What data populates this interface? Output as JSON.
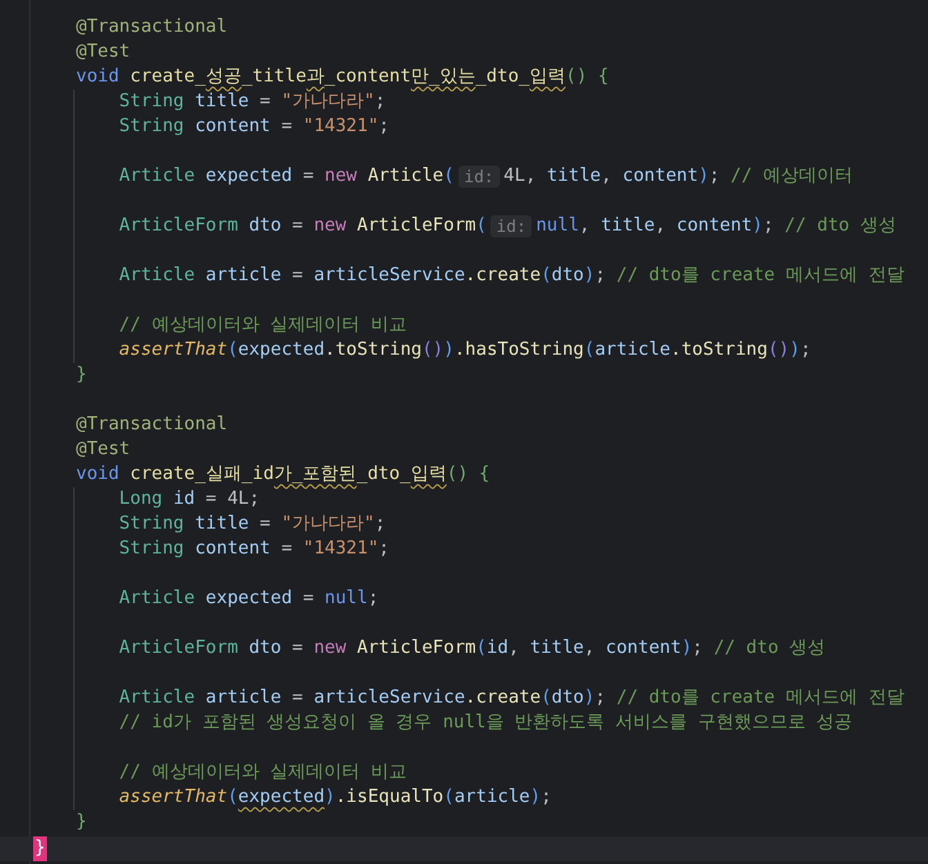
{
  "editor": {
    "lines": [
      {
        "kind": "code",
        "tokens": [
          {
            "text": "@Transactional",
            "kind": "annotation"
          }
        ]
      },
      {
        "kind": "code",
        "tokens": [
          {
            "text": "@Test",
            "kind": "annotation"
          }
        ]
      },
      {
        "kind": "code",
        "tokens": [
          {
            "text": "void ",
            "kind": "keyword"
          },
          {
            "text": "create_",
            "kind": "method"
          },
          {
            "text": "성공",
            "kind": "method",
            "warning": true
          },
          {
            "text": "_title",
            "kind": "method"
          },
          {
            "text": "과",
            "kind": "method",
            "warning": true
          },
          {
            "text": "_content",
            "kind": "method"
          },
          {
            "text": "만_있는",
            "kind": "method",
            "warning": true
          },
          {
            "text": "_dto_",
            "kind": "method"
          },
          {
            "text": "입력",
            "kind": "method",
            "warning": true
          },
          {
            "text": "() {",
            "kind": "brace"
          }
        ],
        "children": [
          {
            "kind": "code",
            "tokens": [
              {
                "text": "String ",
                "kind": "type"
              },
              {
                "text": "title",
                "kind": "var"
              },
              {
                "text": " = ",
                "kind": "plain"
              },
              {
                "text": "\"가나다라\"",
                "kind": "string"
              },
              {
                "text": ";",
                "kind": "plain"
              }
            ]
          },
          {
            "kind": "code",
            "tokens": [
              {
                "text": "String ",
                "kind": "type"
              },
              {
                "text": "content",
                "kind": "var"
              },
              {
                "text": " = ",
                "kind": "plain"
              },
              {
                "text": "\"14321\"",
                "kind": "string"
              },
              {
                "text": ";",
                "kind": "plain"
              }
            ]
          },
          {
            "kind": "blank"
          },
          {
            "kind": "code",
            "tokens": [
              {
                "text": "Article ",
                "kind": "type"
              },
              {
                "text": "expected",
                "kind": "var"
              },
              {
                "text": " = ",
                "kind": "plain"
              },
              {
                "text": "new ",
                "kind": "new"
              },
              {
                "text": "Article",
                "kind": "call"
              },
              {
                "text": "(",
                "kind": "paren"
              },
              {
                "text": "id:",
                "kind": "hint"
              },
              {
                "text": "4L",
                "kind": "plain"
              },
              {
                "text": ", ",
                "kind": "plain"
              },
              {
                "text": "title",
                "kind": "var"
              },
              {
                "text": ", ",
                "kind": "plain"
              },
              {
                "text": "content",
                "kind": "var"
              },
              {
                "text": ")",
                "kind": "paren"
              },
              {
                "text": "; ",
                "kind": "plain"
              },
              {
                "text": "// 예상데이터",
                "kind": "comment"
              }
            ]
          },
          {
            "kind": "blank"
          },
          {
            "kind": "code",
            "tokens": [
              {
                "text": "ArticleForm ",
                "kind": "type"
              },
              {
                "text": "dto",
                "kind": "var"
              },
              {
                "text": " = ",
                "kind": "plain"
              },
              {
                "text": "new ",
                "kind": "new"
              },
              {
                "text": "ArticleForm",
                "kind": "call"
              },
              {
                "text": "(",
                "kind": "paren"
              },
              {
                "text": "id:",
                "kind": "hint"
              },
              {
                "text": "null",
                "kind": "keyword"
              },
              {
                "text": ", ",
                "kind": "plain"
              },
              {
                "text": "title",
                "kind": "var"
              },
              {
                "text": ", ",
                "kind": "plain"
              },
              {
                "text": "content",
                "kind": "var"
              },
              {
                "text": ")",
                "kind": "paren"
              },
              {
                "text": "; ",
                "kind": "plain"
              },
              {
                "text": "// dto 생성",
                "kind": "comment"
              }
            ]
          },
          {
            "kind": "blank"
          },
          {
            "kind": "code",
            "tokens": [
              {
                "text": "Article ",
                "kind": "type"
              },
              {
                "text": "article",
                "kind": "var"
              },
              {
                "text": " = ",
                "kind": "plain"
              },
              {
                "text": "articleService",
                "kind": "var"
              },
              {
                "text": ".create",
                "kind": "call"
              },
              {
                "text": "(",
                "kind": "paren"
              },
              {
                "text": "dto",
                "kind": "var"
              },
              {
                "text": ")",
                "kind": "paren"
              },
              {
                "text": "; ",
                "kind": "plain"
              },
              {
                "text": "// dto를 create 메서드에 전달",
                "kind": "comment"
              }
            ]
          },
          {
            "kind": "blank"
          },
          {
            "kind": "code",
            "tokens": [
              {
                "text": "// 예상데이터와 실제데이터 비교",
                "kind": "comment"
              }
            ]
          },
          {
            "kind": "code",
            "tokens": [
              {
                "text": "assertThat",
                "kind": "static"
              },
              {
                "text": "(",
                "kind": "paren"
              },
              {
                "text": "expected",
                "kind": "var"
              },
              {
                "text": ".toString",
                "kind": "call"
              },
              {
                "text": "()",
                "kind": "paren2"
              },
              {
                "text": ")",
                "kind": "paren"
              },
              {
                "text": ".hasToString",
                "kind": "call"
              },
              {
                "text": "(",
                "kind": "paren"
              },
              {
                "text": "article",
                "kind": "var"
              },
              {
                "text": ".toString",
                "kind": "call"
              },
              {
                "text": "()",
                "kind": "paren2"
              },
              {
                "text": ")",
                "kind": "paren"
              },
              {
                "text": ";",
                "kind": "plain"
              }
            ]
          }
        ]
      },
      {
        "kind": "code",
        "tokens": [
          {
            "text": "}",
            "kind": "brace"
          }
        ]
      },
      {
        "kind": "blank"
      },
      {
        "kind": "code",
        "tokens": [
          {
            "text": "@Transactional",
            "kind": "annotation"
          }
        ]
      },
      {
        "kind": "code",
        "tokens": [
          {
            "text": "@Test",
            "kind": "annotation"
          }
        ]
      },
      {
        "kind": "code",
        "tokens": [
          {
            "text": "void ",
            "kind": "keyword"
          },
          {
            "text": "create_실패_id",
            "kind": "method"
          },
          {
            "text": "가_포함된",
            "kind": "method",
            "warning": true
          },
          {
            "text": "_dto_",
            "kind": "method"
          },
          {
            "text": "입력",
            "kind": "method",
            "warning": true
          },
          {
            "text": "() {",
            "kind": "brace"
          }
        ],
        "children": [
          {
            "kind": "code",
            "tokens": [
              {
                "text": "Long ",
                "kind": "type"
              },
              {
                "text": "id",
                "kind": "var"
              },
              {
                "text": " = 4L;",
                "kind": "plain"
              }
            ]
          },
          {
            "kind": "code",
            "tokens": [
              {
                "text": "String ",
                "kind": "type"
              },
              {
                "text": "title",
                "kind": "var"
              },
              {
                "text": " = ",
                "kind": "plain"
              },
              {
                "text": "\"가나다라\"",
                "kind": "string"
              },
              {
                "text": ";",
                "kind": "plain"
              }
            ]
          },
          {
            "kind": "code",
            "tokens": [
              {
                "text": "String ",
                "kind": "type"
              },
              {
                "text": "content",
                "kind": "var"
              },
              {
                "text": " = ",
                "kind": "plain"
              },
              {
                "text": "\"14321\"",
                "kind": "string"
              },
              {
                "text": ";",
                "kind": "plain"
              }
            ]
          },
          {
            "kind": "blank"
          },
          {
            "kind": "code",
            "tokens": [
              {
                "text": "Article ",
                "kind": "type"
              },
              {
                "text": "expected",
                "kind": "var"
              },
              {
                "text": " = ",
                "kind": "plain"
              },
              {
                "text": "null",
                "kind": "keyword"
              },
              {
                "text": ";",
                "kind": "plain"
              }
            ]
          },
          {
            "kind": "blank"
          },
          {
            "kind": "code",
            "tokens": [
              {
                "text": "ArticleForm ",
                "kind": "type"
              },
              {
                "text": "dto",
                "kind": "var"
              },
              {
                "text": " = ",
                "kind": "plain"
              },
              {
                "text": "new ",
                "kind": "new"
              },
              {
                "text": "ArticleForm",
                "kind": "call"
              },
              {
                "text": "(",
                "kind": "paren"
              },
              {
                "text": "id",
                "kind": "var"
              },
              {
                "text": ", ",
                "kind": "plain"
              },
              {
                "text": "title",
                "kind": "var"
              },
              {
                "text": ", ",
                "kind": "plain"
              },
              {
                "text": "content",
                "kind": "var"
              },
              {
                "text": ")",
                "kind": "paren"
              },
              {
                "text": "; ",
                "kind": "plain"
              },
              {
                "text": "// dto 생성",
                "kind": "comment"
              }
            ]
          },
          {
            "kind": "blank"
          },
          {
            "kind": "code",
            "tokens": [
              {
                "text": "Article ",
                "kind": "type"
              },
              {
                "text": "article",
                "kind": "var"
              },
              {
                "text": " = ",
                "kind": "plain"
              },
              {
                "text": "articleService",
                "kind": "var"
              },
              {
                "text": ".create",
                "kind": "call"
              },
              {
                "text": "(",
                "kind": "paren"
              },
              {
                "text": "dto",
                "kind": "var"
              },
              {
                "text": ")",
                "kind": "paren"
              },
              {
                "text": "; ",
                "kind": "plain"
              },
              {
                "text": "// dto를 create 메서드에 전달",
                "kind": "comment"
              }
            ]
          },
          {
            "kind": "code",
            "tokens": [
              {
                "text": "// id가 포함된 생성요청이 올 경우 null을 반환하도록 서비스를 구현했으므로 성공",
                "kind": "comment"
              }
            ]
          },
          {
            "kind": "blank"
          },
          {
            "kind": "code",
            "tokens": [
              {
                "text": "// 예상데이터와 실제데이터 비교",
                "kind": "comment"
              }
            ]
          },
          {
            "kind": "code",
            "tokens": [
              {
                "text": "assertThat",
                "kind": "static"
              },
              {
                "text": "(",
                "kind": "paren"
              },
              {
                "text": "expected",
                "kind": "var",
                "warning": true
              },
              {
                "text": ")",
                "kind": "paren"
              },
              {
                "text": ".isEqualTo",
                "kind": "call"
              },
              {
                "text": "(",
                "kind": "paren"
              },
              {
                "text": "article",
                "kind": "var"
              },
              {
                "text": ")",
                "kind": "paren"
              },
              {
                "text": ";",
                "kind": "plain"
              }
            ]
          }
        ]
      },
      {
        "kind": "code",
        "tokens": [
          {
            "text": "}",
            "kind": "brace"
          }
        ]
      }
    ],
    "closing_brace": {
      "text": "}",
      "matched": true
    }
  }
}
